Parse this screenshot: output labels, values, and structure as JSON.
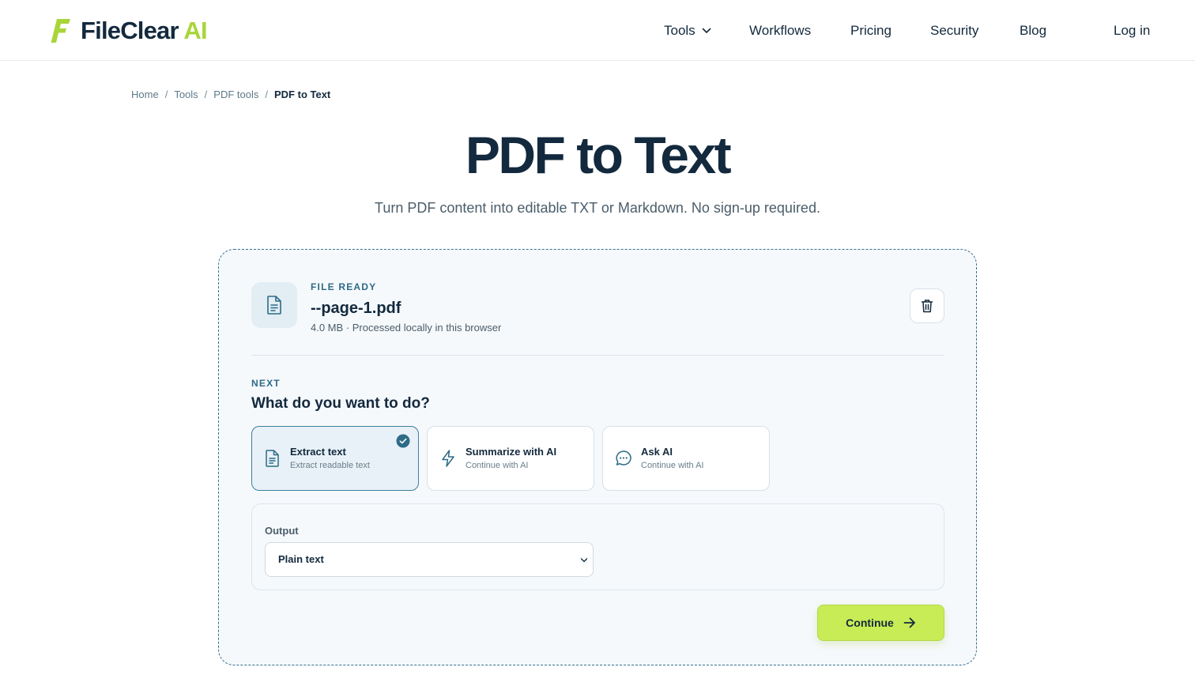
{
  "header": {
    "brand_name": "FileClear",
    "brand_suffix": "AI",
    "nav": {
      "tools": "Tools",
      "workflows": "Workflows",
      "pricing": "Pricing",
      "security": "Security",
      "blog": "Blog",
      "login": "Log in"
    }
  },
  "breadcrumb": {
    "home": "Home",
    "tools": "Tools",
    "pdf_tools": "PDF tools",
    "current": "PDF to Text",
    "separator": "/"
  },
  "page": {
    "title": "PDF to Text",
    "subtitle": "Turn PDF content into editable TXT or Markdown. No sign-up required."
  },
  "file": {
    "status": "FILE READY",
    "name": "--page-1.pdf",
    "meta": "4.0 MB · Processed locally in this browser",
    "icon": "document-icon",
    "delete_icon": "trash-icon"
  },
  "next": {
    "label": "NEXT",
    "question": "What do you want to do?",
    "options": [
      {
        "title": "Extract text",
        "subtitle": "Extract readable text",
        "icon": "document-icon",
        "selected": true
      },
      {
        "title": "Summarize with AI",
        "subtitle": "Continue with AI",
        "icon": "lightning-icon",
        "selected": false
      },
      {
        "title": "Ask AI",
        "subtitle": "Continue with AI",
        "icon": "chat-bubble-icon",
        "selected": false
      }
    ]
  },
  "output": {
    "label": "Output",
    "selected_value": "Plain text"
  },
  "actions": {
    "continue_label": "Continue"
  },
  "colors": {
    "brand_green": "#a9d53a",
    "navy": "#13293d",
    "accent_blue": "#2d6b86",
    "button_lime": "#c8ec55"
  }
}
